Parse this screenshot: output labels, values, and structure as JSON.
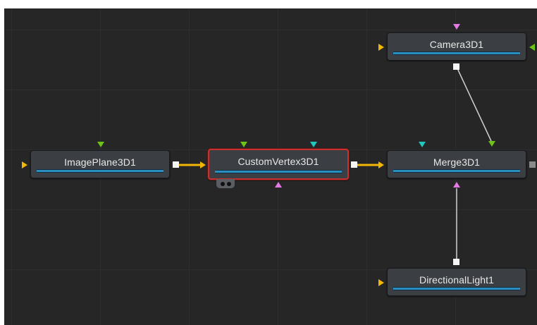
{
  "colors": {
    "canvas_bg": "#262626",
    "node_bg": "#3b3e42",
    "node_bar": "#2a8fc0",
    "selected_border": "#c8322e",
    "background_input": "#f2b705",
    "foreground_input": "#6cc417",
    "effect_mask_input": "#20c9c0",
    "scene_input": "#e27ae6",
    "output_port": "#f5f5f5",
    "wire_selected": "#f2b705",
    "wire_normal": "#d0d0d0"
  },
  "nodes": {
    "image_plane": {
      "label": "ImagePlane3D1",
      "selected": false
    },
    "custom_vertex": {
      "label": "CustomVertex3D1",
      "selected": true
    },
    "merge": {
      "label": "Merge3D1",
      "selected": false
    },
    "camera": {
      "label": "Camera3D1",
      "selected": false
    },
    "directional_light": {
      "label": "DirectionalLight1",
      "selected": false
    }
  },
  "connections": [
    {
      "from": "ImagePlane3D1",
      "to": "CustomVertex3D1"
    },
    {
      "from": "CustomVertex3D1",
      "to": "Merge3D1"
    },
    {
      "from": "Camera3D1",
      "to": "Merge3D1"
    },
    {
      "from": "DirectionalLight1",
      "to": "Merge3D1"
    }
  ]
}
